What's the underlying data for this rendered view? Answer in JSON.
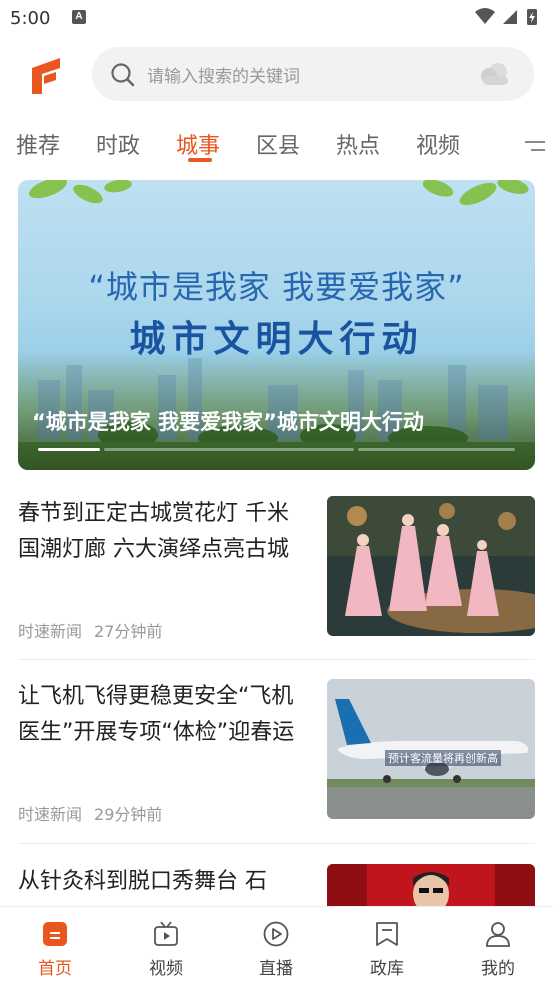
{
  "status_bar": {
    "time": "5:00",
    "notif_glyph": "A"
  },
  "header": {
    "search_placeholder": "请输入搜索的关键词",
    "icons": [
      "logo-icon",
      "search-icon",
      "weather-cloud-icon"
    ]
  },
  "tabs": [
    {
      "label": "推荐"
    },
    {
      "label": "时政"
    },
    {
      "label": "城事"
    },
    {
      "label": "区县"
    },
    {
      "label": "热点"
    },
    {
      "label": "视频"
    }
  ],
  "active_tab": "城事",
  "banner": {
    "slogan_line1": "“城市是我家  我要爱我家”",
    "slogan_line2": "城市文明大行动",
    "caption": "“城市是我家 我要爱我家”城市文明大行动",
    "slide_count": 3,
    "active_slide": 1
  },
  "news": [
    {
      "title": "春节到正定古城赏花灯 千米国潮灯廊 六大演绎点亮古城",
      "source": "时速新闻",
      "time": "27分钟前"
    },
    {
      "title": "让飞机飞得更稳更安全“飞机医生”开展专项“体检”迎春运",
      "source": "时速新闻",
      "time": "29分钟前",
      "image_text": "预计客流量将再创新高"
    },
    {
      "title": "从针灸科到脱口秀舞台 石",
      "source": "",
      "time": ""
    }
  ],
  "bottom_nav": [
    {
      "label": "首页"
    },
    {
      "label": "视频"
    },
    {
      "label": "直播"
    },
    {
      "label": "政库"
    },
    {
      "label": "我的"
    }
  ],
  "colors": {
    "accent": "#e8571f",
    "muted": "#999999"
  }
}
